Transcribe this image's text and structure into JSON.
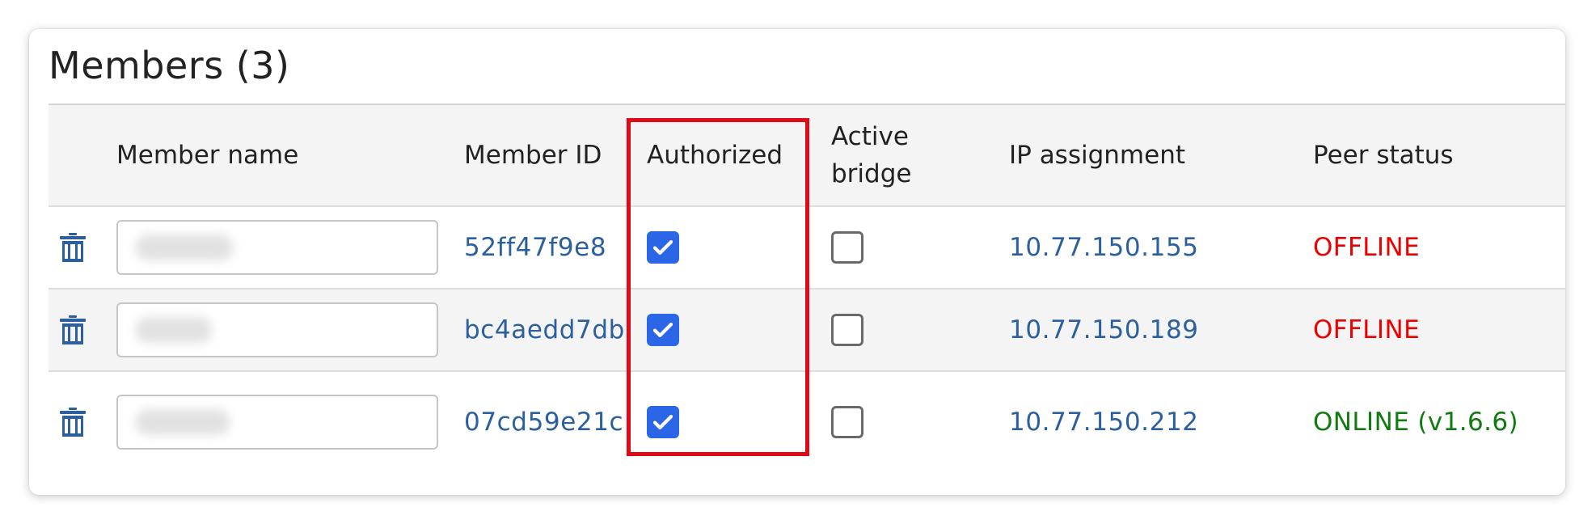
{
  "title": "Members (3)",
  "columns": {
    "member_name": "Member name",
    "member_id": "Member ID",
    "authorized": "Authorized",
    "active_bridge_line1": "Active",
    "active_bridge_line2": "bridge",
    "ip_assignment": "IP assignment",
    "peer_status": "Peer status"
  },
  "members": [
    {
      "id": "52ff47f9e8",
      "authorized": true,
      "active_bridge": false,
      "ip": "10.77.150.155",
      "status": "OFFLINE"
    },
    {
      "id": "bc4aedd7db",
      "authorized": true,
      "active_bridge": false,
      "ip": "10.77.150.189",
      "status": "OFFLINE"
    },
    {
      "id": "07cd59e21c",
      "authorized": true,
      "active_bridge": false,
      "ip": "10.77.150.212",
      "status": "ONLINE (v1.6.6)"
    }
  ],
  "colors": {
    "link": "#2b5f9e",
    "offline": "#ec0000",
    "online": "#117a11",
    "checkbox": "#2b66e6",
    "highlight": "#e00a16"
  },
  "icons": {
    "delete": "trash-icon",
    "check": "check-icon"
  }
}
